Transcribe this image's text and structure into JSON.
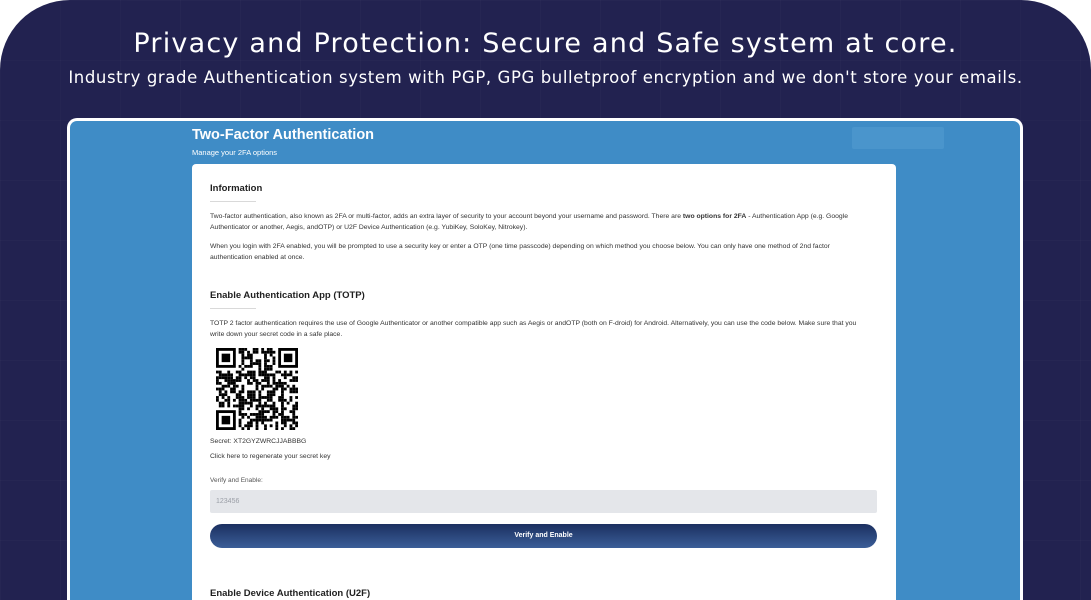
{
  "banner": {
    "headline_bold": "Privacy and Protection",
    "headline_rest": ": Secure and Safe system at core.",
    "subline": "Industry grade Authentication system with PGP, GPG bulletproof encryption and we don't store your emails."
  },
  "page": {
    "title": "Two-Factor Authentication",
    "subtitle": "Manage your 2FA options"
  },
  "information": {
    "heading": "Information",
    "para1_pre": "Two-factor authentication, also known as 2FA or multi-factor, adds an extra layer of security to your account beyond your username and password. There are ",
    "para1_bold": "two options for 2FA",
    "para1_post": " - Authentication App (e.g. Google Authenticator or another, Aegis, andOTP) or U2F Device Authentication (e.g. YubiKey, SoloKey, Nitrokey).",
    "para2": "When you login with 2FA enabled, you will be prompted to use a security key or enter a OTP (one time passcode) depending on which method you choose below. You can only have one method of 2nd factor authentication enabled at once."
  },
  "totp": {
    "heading": "Enable Authentication App (TOTP)",
    "description": "TOTP 2 factor authentication requires the use of Google Authenticator or another compatible app such as Aegis or andOTP (both on F-droid) for Android. Alternatively, you can use the code below. Make sure that you write down your secret code in a safe place.",
    "qr_icon": "qr-code",
    "secret_line": "Secret: XT2GYZWRCJJABBBG",
    "regenerate_link": "Click here to regenerate your secret key",
    "verify_label": "Verify and Enable:",
    "verify_placeholder": "123456",
    "verify_button": "Verify and Enable"
  },
  "u2f": {
    "heading": "Enable Device Authentication (U2F)"
  },
  "colors": {
    "banner_bg": "#222250",
    "screen_bg": "#3f8cc6",
    "button_gradient_top": "#1b2f60",
    "button_gradient_bottom": "#3b5e98"
  }
}
